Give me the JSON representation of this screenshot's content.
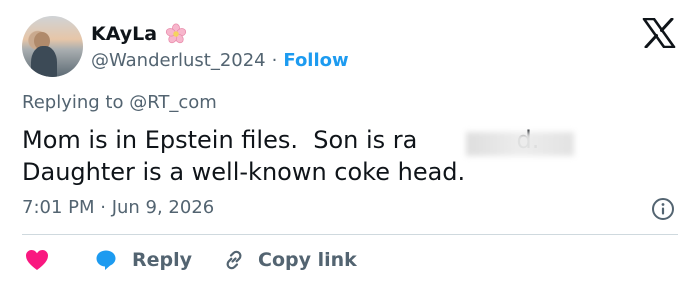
{
  "user": {
    "name": "KAyLa",
    "handle": "@Wanderlust_2024",
    "separator": "·",
    "follow_label": "Follow"
  },
  "tweet": {
    "replying_to": "Replying to @RT_com",
    "line1": "Mom is in Epstein files.  Son is ra             d.",
    "line2": "Daughter is a well-known coke head.",
    "timestamp": "7:01 PM · Jun 9, 2026"
  },
  "actions": {
    "reply_label": "Reply",
    "copy_link_label": "Copy link"
  },
  "icons": {
    "logo": "x-logo-icon",
    "badge": "cherry-blossom-icon",
    "like": "heart-icon",
    "reply": "speech-bubble-icon",
    "copy": "link-icon",
    "info": "info-icon"
  },
  "colors": {
    "accent": "#1d9bf0",
    "heart": "#f91880",
    "secondary_text": "#536471",
    "primary_text": "#0f1419"
  }
}
